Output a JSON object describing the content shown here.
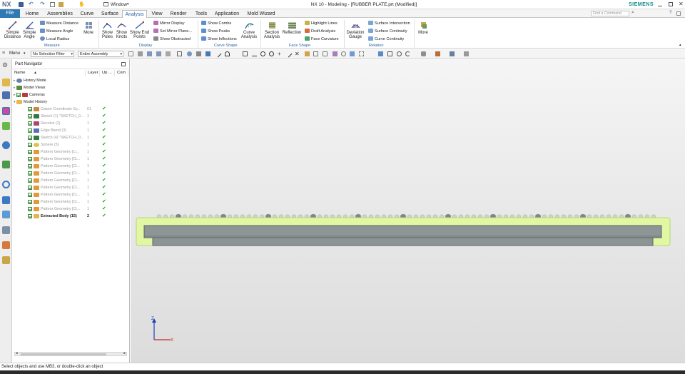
{
  "window": {
    "app": "NX",
    "title": "NX 10 - Modeling - [RUBBER PLATE.prt (Modified)]",
    "window_menu": "Window",
    "search_placeholder": "Find a Command",
    "brand": "SIEMENS"
  },
  "tabs": [
    "File",
    "Home",
    "Assemblies",
    "Curve",
    "Surface",
    "Analysis",
    "View",
    "Render",
    "Tools",
    "Application",
    "Mold Wizard"
  ],
  "ribbon": {
    "simple_distance": "Simple Distance",
    "simple_angle": "Simple Angle",
    "measure_distance": "Measure Distance",
    "measure_angle": "Measure Angle",
    "local_radius": "Local Radius",
    "more": "More",
    "measure_group": "Measure",
    "show_poles": "Show Poles",
    "show_knots": "Show Knots",
    "show_end_points": "Show End Points",
    "mirror_display": "Mirror Display",
    "set_mirror_plane": "Set Mirror Plane...",
    "show_obstructed": "Show Obstructed",
    "display_group": "Display",
    "show_combs": "Show Combs",
    "show_peaks": "Show Peaks",
    "show_inflections": "Show Inflections",
    "curve_analysis": "Curve Analysis",
    "curve_shape_group": "Curve Shape",
    "section_analysis": "Section Analysis",
    "reflection": "Reflection",
    "highlight_lines": "Highlight Lines",
    "draft_analysis": "Draft Analysis",
    "face_curvature": "Face Curvature",
    "face_shape_group": "Face Shape",
    "deviation_gauge": "Deviation Gauge",
    "surface_intersection": "Surface Intersection",
    "surface_continuity": "Surface Continuity",
    "curve_continuity": "Curve Continuity",
    "relation_group": "Relation",
    "more2": "More"
  },
  "toolbar": {
    "menu": "Menu",
    "selection_filter": "No Selection Filter",
    "assembly_scope": "Entire Assembly"
  },
  "navigator": {
    "title": "Part Navigator",
    "columns": [
      "Name",
      "Layer",
      "Up ...",
      "Com"
    ],
    "rows": [
      {
        "name": "History Mode",
        "layer": "",
        "up": false,
        "indent": 0,
        "gray": false,
        "check": false,
        "icon": "clock"
      },
      {
        "name": "Model Views",
        "layer": "",
        "up": false,
        "indent": 0,
        "gray": false,
        "check": false,
        "icon": "views"
      },
      {
        "name": "Cameras",
        "layer": "",
        "up": false,
        "indent": 0,
        "gray": false,
        "check": true,
        "icon": "camera"
      },
      {
        "name": "Model History",
        "layer": "",
        "up": false,
        "indent": 0,
        "gray": false,
        "check": false,
        "icon": "folder"
      },
      {
        "name": "Datum Coordinate Sy...",
        "layer": "61",
        "up": true,
        "indent": 1,
        "gray": true,
        "check": true,
        "icon": "datum"
      },
      {
        "name": "Sketch (1) \"SKETCH_0...",
        "layer": "1",
        "up": true,
        "indent": 1,
        "gray": true,
        "check": true,
        "icon": "sketch"
      },
      {
        "name": "Revolve (2)",
        "layer": "1",
        "up": true,
        "indent": 1,
        "gray": true,
        "check": true,
        "icon": "revolve"
      },
      {
        "name": "Edge Blend (3)",
        "layer": "1",
        "up": true,
        "indent": 1,
        "gray": true,
        "check": true,
        "icon": "blend"
      },
      {
        "name": "Sketch (4) \"SKETCH_0...",
        "layer": "1",
        "up": true,
        "indent": 1,
        "gray": true,
        "check": true,
        "icon": "sketch"
      },
      {
        "name": "Sphere (5)",
        "layer": "1",
        "up": true,
        "indent": 1,
        "gray": true,
        "check": true,
        "icon": "sphere"
      },
      {
        "name": "Pattern Geometry [Li...",
        "layer": "1",
        "up": true,
        "indent": 1,
        "gray": true,
        "check": true,
        "icon": "pattern"
      },
      {
        "name": "Pattern Geometry [Ci...",
        "layer": "1",
        "up": true,
        "indent": 1,
        "gray": true,
        "check": true,
        "icon": "pattern"
      },
      {
        "name": "Pattern Geometry [Ci...",
        "layer": "1",
        "up": true,
        "indent": 1,
        "gray": true,
        "check": true,
        "icon": "pattern"
      },
      {
        "name": "Pattern Geometry [Ci...",
        "layer": "1",
        "up": true,
        "indent": 1,
        "gray": true,
        "check": true,
        "icon": "pattern"
      },
      {
        "name": "Pattern Geometry [Ci...",
        "layer": "1",
        "up": true,
        "indent": 1,
        "gray": true,
        "check": true,
        "icon": "pattern"
      },
      {
        "name": "Pattern Geometry [Ci...",
        "layer": "1",
        "up": true,
        "indent": 1,
        "gray": true,
        "check": true,
        "icon": "pattern"
      },
      {
        "name": "Pattern Geometry [Ci...",
        "layer": "1",
        "up": true,
        "indent": 1,
        "gray": true,
        "check": true,
        "icon": "pattern"
      },
      {
        "name": "Pattern Geometry [Ci...",
        "layer": "1",
        "up": true,
        "indent": 1,
        "gray": true,
        "check": true,
        "icon": "pattern"
      },
      {
        "name": "Pattern Geometry [Ci...",
        "layer": "1",
        "up": true,
        "indent": 1,
        "gray": true,
        "check": true,
        "icon": "pattern"
      },
      {
        "name": "Extracted Body (15)",
        "layer": "2",
        "up": true,
        "indent": 1,
        "gray": false,
        "bold": true,
        "check": true,
        "icon": "extract"
      }
    ]
  },
  "status": {
    "message": "Select objects and use MB3, or double-click an object"
  },
  "colors": {
    "file_tab": "#2d7ab5",
    "accent": "#2d63a6",
    "plate_green": "#e2f7a4",
    "plate_gray": "#8e9596",
    "check_green": "#1fa01f"
  }
}
